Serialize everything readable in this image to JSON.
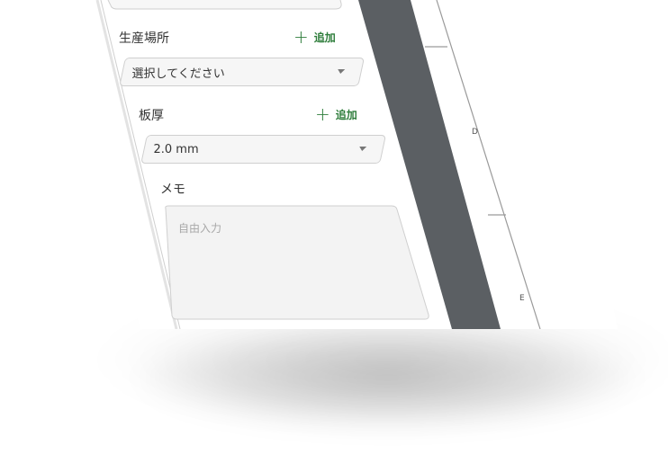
{
  "form": {
    "production_site": {
      "label": "生産場所",
      "add_label": "追加",
      "select_placeholder": "選択してください"
    },
    "thickness": {
      "label": "板厚",
      "add_label": "追加",
      "selected_value": "2.0 mm"
    },
    "memo": {
      "label": "メモ",
      "placeholder": "自由入力"
    }
  },
  "ruler": {
    "labels": [
      "D",
      "E"
    ]
  },
  "icons": {
    "add": "plus-icon",
    "dropdown": "chevron-down-icon"
  },
  "colors": {
    "accent_green": "#2e7d3b",
    "dark_strip": "#5b5f63",
    "field_bg": "#f6f6f6"
  }
}
